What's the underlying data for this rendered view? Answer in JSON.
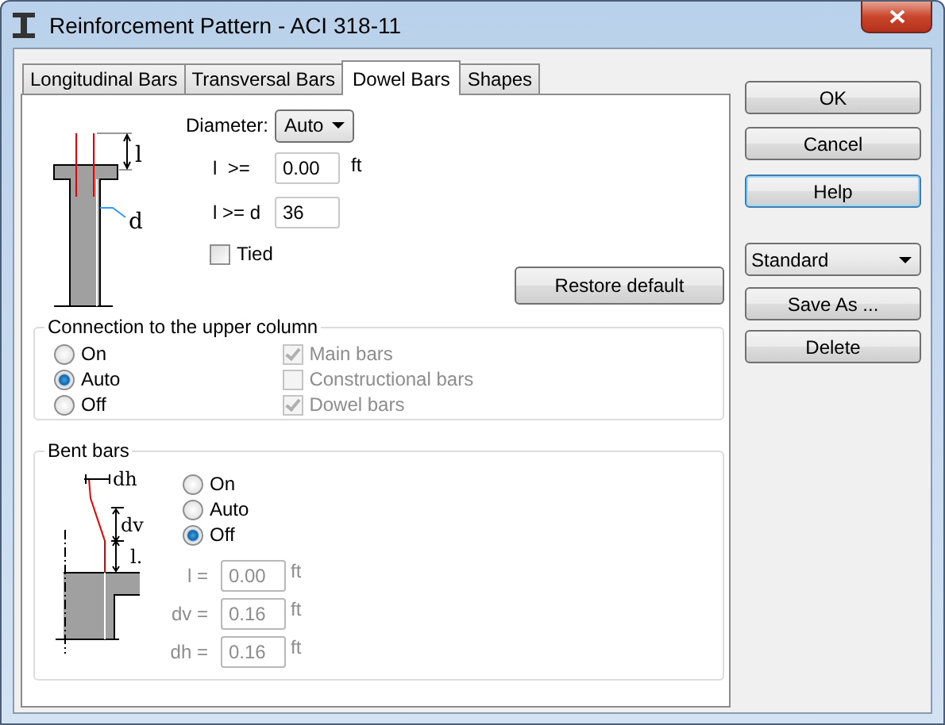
{
  "window": {
    "title": "Reinforcement Pattern - ACI 318-11"
  },
  "tabs": [
    {
      "label": "Longitudinal Bars",
      "selected": false
    },
    {
      "label": "Transversal Bars",
      "selected": false
    },
    {
      "label": "Dowel Bars",
      "selected": true
    },
    {
      "label": "Shapes",
      "selected": false
    }
  ],
  "dowel": {
    "diagram_labels": [
      "l",
      "d"
    ],
    "diameter": {
      "label": "Diameter:",
      "value": "Auto"
    },
    "fields": [
      {
        "label": "l  >=",
        "value": "0.00",
        "unit": "ft"
      },
      {
        "label": "l >= d",
        "value": "36"
      }
    ],
    "tied": {
      "label": "Tied",
      "checked": false
    },
    "restore_button": "Restore default"
  },
  "connection": {
    "title": "Connection to the upper column",
    "options": [
      {
        "label": "On",
        "selected": false
      },
      {
        "label": "Auto",
        "selected": true
      },
      {
        "label": "Off",
        "selected": false
      }
    ],
    "bars": [
      {
        "label": "Main bars",
        "checked": true,
        "disabled": true
      },
      {
        "label": "Constructional bars",
        "checked": false,
        "disabled": true
      },
      {
        "label": "Dowel bars",
        "checked": true,
        "disabled": true
      }
    ]
  },
  "bent_bars": {
    "title": "Bent bars",
    "diagram_labels": [
      "dh",
      "dv",
      "l."
    ],
    "options": [
      {
        "label": "On",
        "selected": false
      },
      {
        "label": "Auto",
        "selected": false
      },
      {
        "label": "Off",
        "selected": true
      }
    ],
    "fields": [
      {
        "label": "l =",
        "value": "0.00",
        "unit": "ft",
        "disabled": true
      },
      {
        "label": "dv =",
        "value": "0.16",
        "unit": "ft",
        "disabled": true
      },
      {
        "label": "dh =",
        "value": "0.16",
        "unit": "ft",
        "disabled": true
      }
    ]
  },
  "buttons": [
    {
      "label": "OK",
      "focused": false
    },
    {
      "label": "Cancel",
      "focused": false
    },
    {
      "label": "Help",
      "focused": true
    }
  ],
  "preset": {
    "value": "Standard"
  },
  "preset_buttons": [
    "Save As ...",
    "Delete"
  ]
}
